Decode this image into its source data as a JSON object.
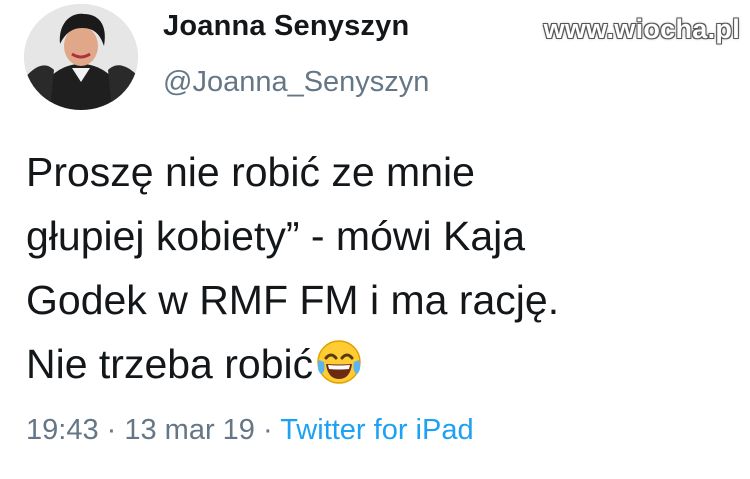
{
  "author": {
    "display_name": "Joanna Senyszyn",
    "handle": "@Joanna_Senyszyn"
  },
  "watermark": "www.wiocha.pl",
  "tweet": {
    "lines": [
      "Proszę nie robić ze mnie",
      "głupiej kobiety” - mówi Kaja",
      "Godek w RMF FM i ma rację.",
      "Nie trzeba robić"
    ],
    "emoji": "face-with-tears-of-joy-icon"
  },
  "meta": {
    "time": "19:43",
    "sep1": " · ",
    "date": "13 mar 19",
    "sep2": " · ",
    "source": "Twitter for iPad"
  },
  "colors": {
    "text": "#14171a",
    "secondary": "#657786",
    "link": "#1da1f2"
  }
}
